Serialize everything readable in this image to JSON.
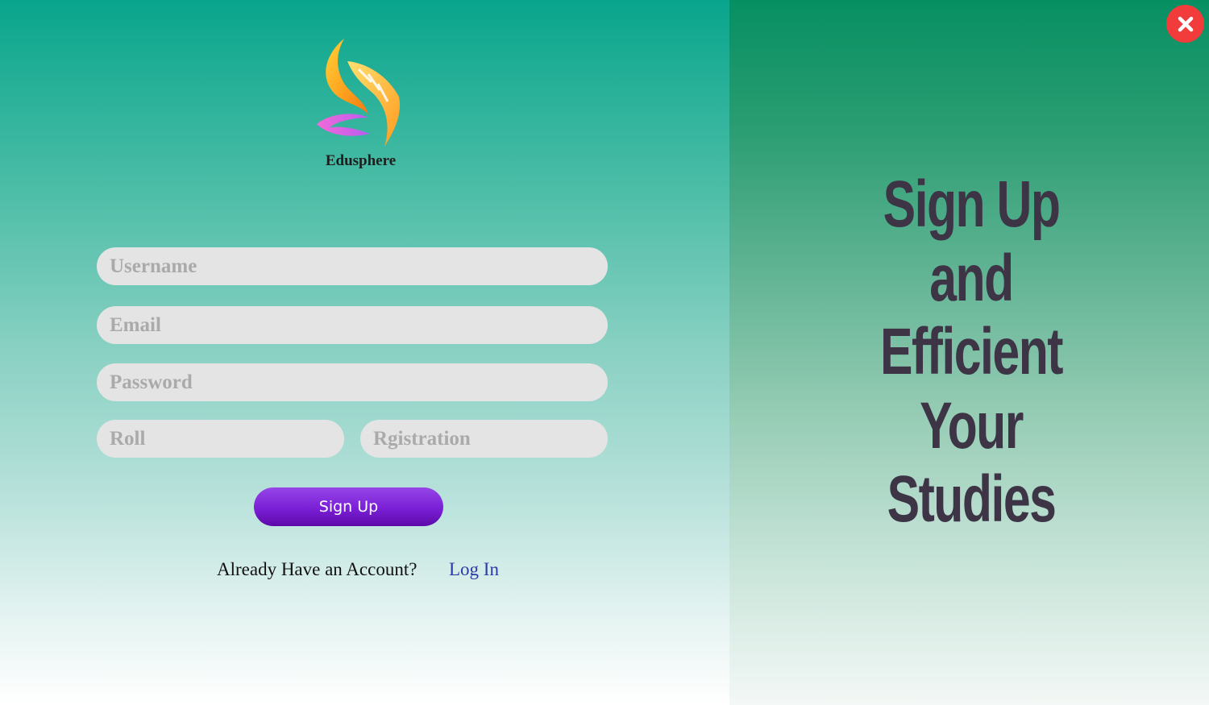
{
  "brand": {
    "name": "Edusphere",
    "icon": "flame-leaf-logo"
  },
  "form": {
    "username_placeholder": "Username",
    "email_placeholder": "Email",
    "password_placeholder": "Password",
    "roll_placeholder": "Roll",
    "registration_placeholder": "Rgistration",
    "submit_label": "Sign Up"
  },
  "footer": {
    "prompt": "Already Have an Account?",
    "login_label": "Log In"
  },
  "tagline": {
    "lines": [
      "Sign Up",
      "and",
      "Efficient",
      "Your",
      "Studies"
    ]
  },
  "close": {
    "icon": "close-icon"
  },
  "colors": {
    "accent_purple": "#7a1fd6",
    "close_red": "#f23b3b",
    "tagline_text": "#3d3446",
    "link_blue": "#2b3aa6"
  }
}
